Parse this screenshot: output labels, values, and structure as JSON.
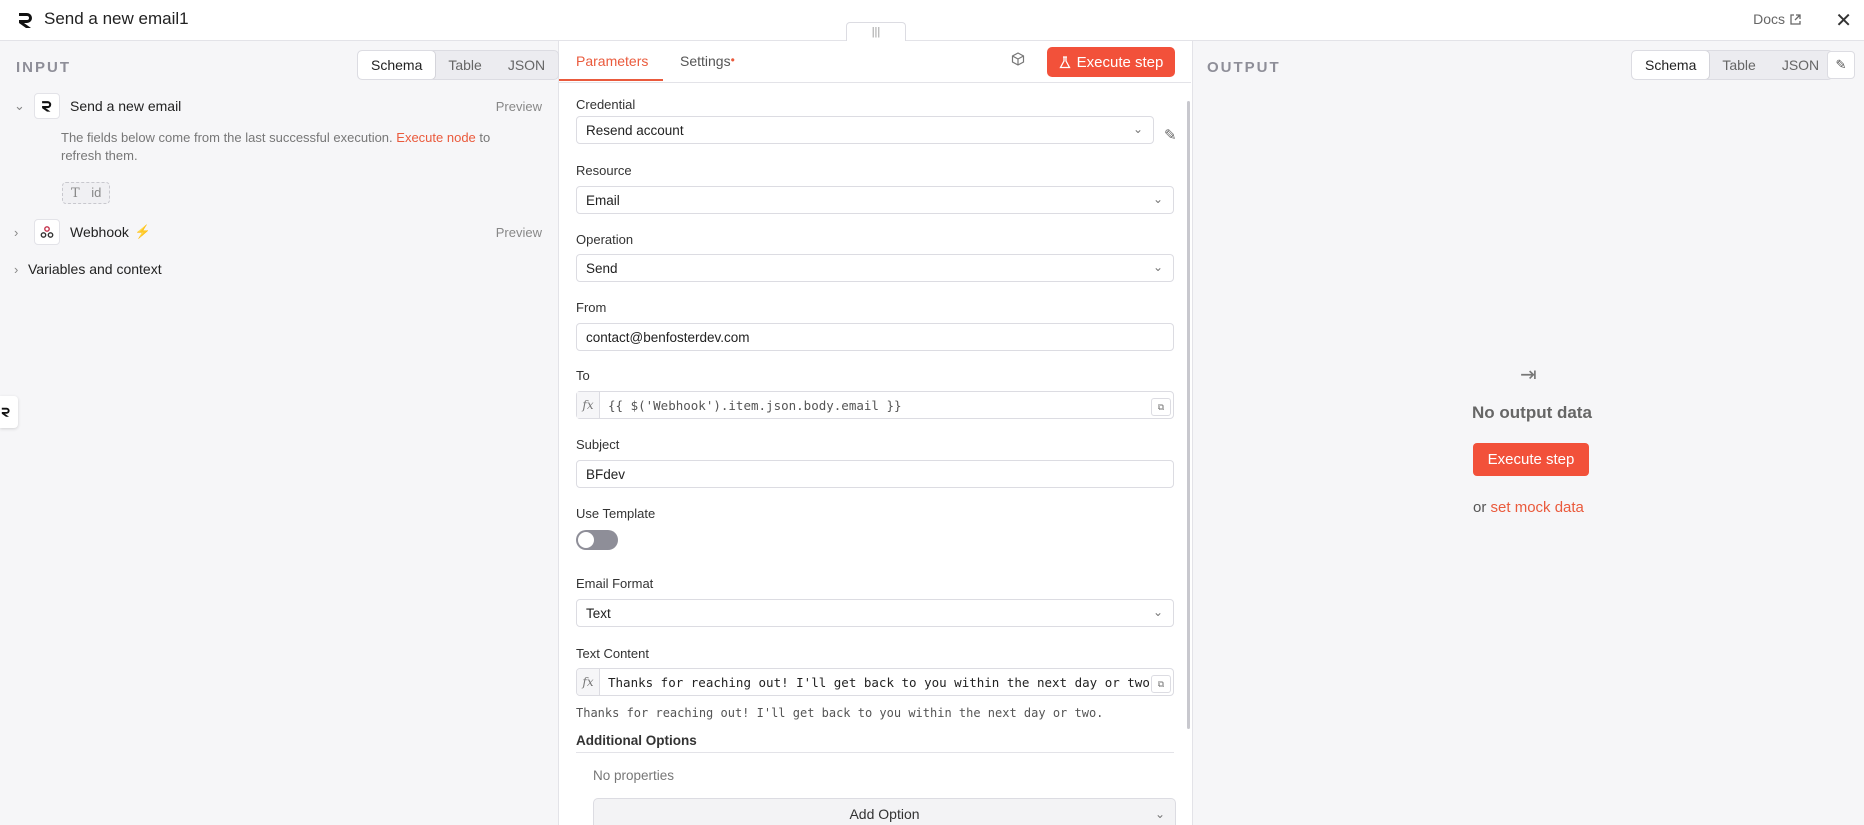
{
  "window": {
    "title": "Send a new email1",
    "docs_label": "Docs"
  },
  "input": {
    "heading": "INPUT",
    "view_tabs": [
      "Schema",
      "Table",
      "JSON"
    ],
    "active_view": "Schema",
    "nodes": [
      {
        "label": "Send a new email",
        "preview": "Preview"
      },
      {
        "label": "Webhook",
        "preview": "Preview"
      }
    ],
    "hint_prefix": "The fields below come from the last successful execution.",
    "hint_link": "Execute node",
    "hint_suffix": "to refresh them.",
    "field_pill": "id",
    "vars_label": "Variables and context"
  },
  "params": {
    "tabs": [
      "Parameters",
      "Settings"
    ],
    "execute_label": "Execute step",
    "fields": {
      "credential": {
        "label": "Credential",
        "value": "Resend account"
      },
      "resource": {
        "label": "Resource",
        "value": "Email"
      },
      "operation": {
        "label": "Operation",
        "value": "Send"
      },
      "from": {
        "label": "From",
        "value": "contact@benfosterdev.com"
      },
      "to": {
        "label": "To",
        "value": "{{ $('Webhook').item.json.body.email }}"
      },
      "subject": {
        "label": "Subject",
        "value": "BFdev"
      },
      "use_template": {
        "label": "Use Template",
        "on": false
      },
      "email_format": {
        "label": "Email Format",
        "value": "Text"
      },
      "text_content": {
        "label": "Text Content",
        "value": "Thanks for reaching out! I'll get back to you within the next day or two.",
        "preview": "Thanks for reaching out! I'll get back to you within the next day or two."
      }
    },
    "additional_options": {
      "heading": "Additional Options",
      "empty_text": "No properties",
      "add_label": "Add Option"
    }
  },
  "output": {
    "heading": "OUTPUT",
    "view_tabs": [
      "Schema",
      "Table",
      "JSON"
    ],
    "active_view": "Schema",
    "empty_title": "No output data",
    "execute_label": "Execute step",
    "or_text": "or",
    "mock_link": "set mock data"
  },
  "colors": {
    "accent": "#f2513a",
    "link": "#ea5a3c"
  },
  "icons": [
    "resend-logo-icon",
    "external-link-icon",
    "close-icon",
    "chevron-down-icon",
    "chevron-right-icon",
    "webhook-icon",
    "bolt-icon",
    "text-type-icon",
    "flask-icon",
    "cube-icon",
    "pencil-icon",
    "fx-icon",
    "expand-icon",
    "arrow-to-line-icon"
  ]
}
